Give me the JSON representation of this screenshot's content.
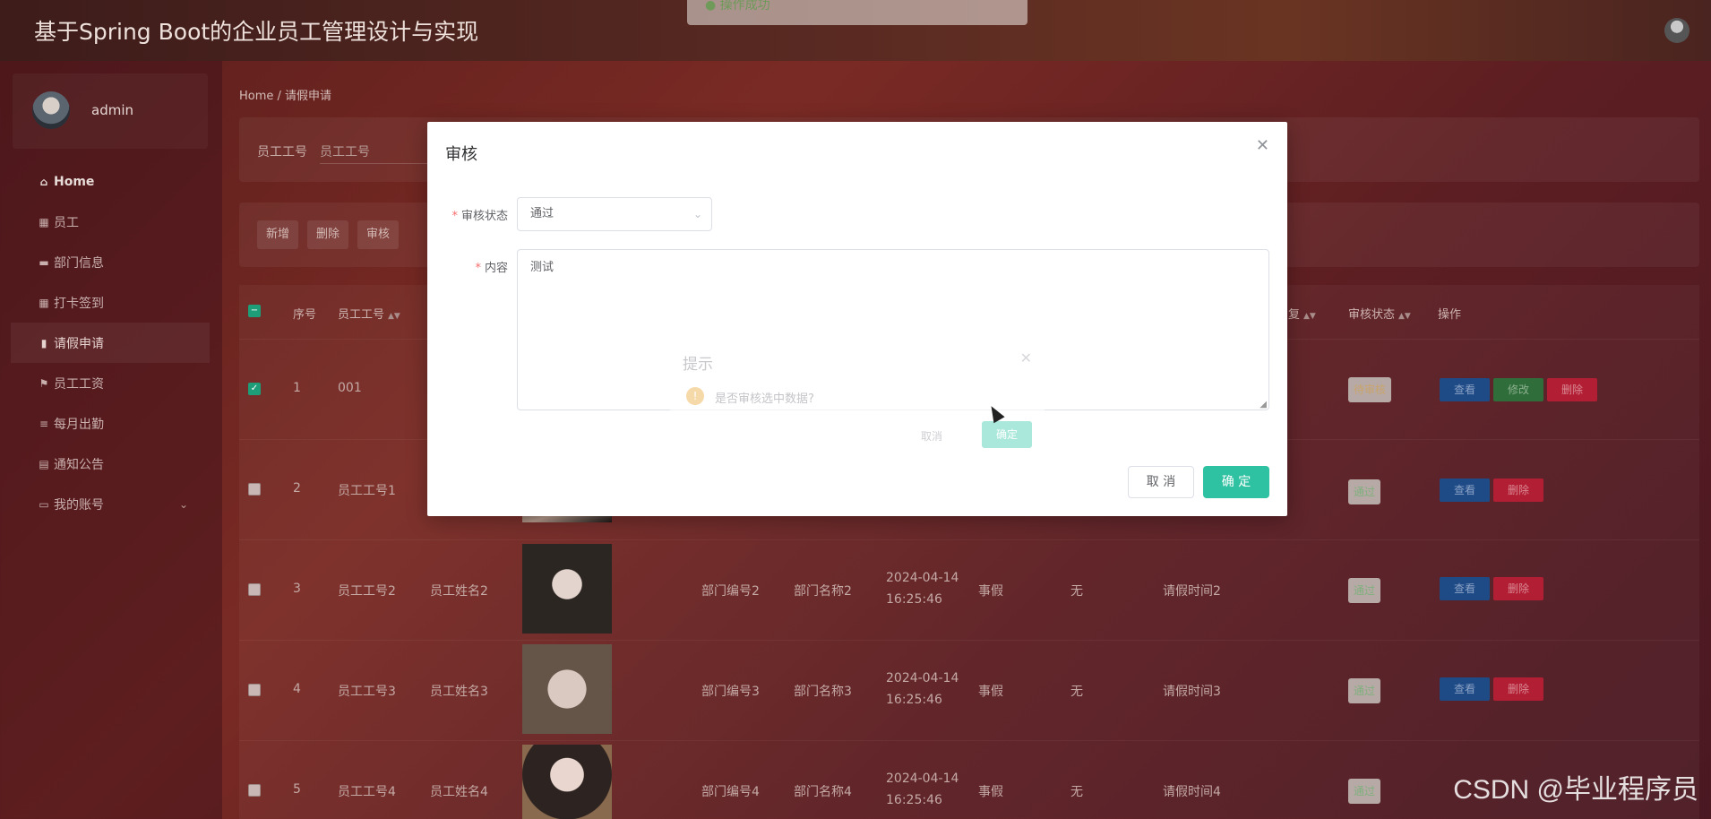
{
  "app": {
    "title": "基于Spring Boot的企业员工管理设计与实现"
  },
  "toast": {
    "text": "操作成功"
  },
  "sidebar": {
    "user": "admin",
    "items": [
      {
        "label": "Home",
        "icon": "home-icon"
      },
      {
        "label": "员工",
        "icon": "grid-icon"
      },
      {
        "label": "部门信息",
        "icon": "chat-icon"
      },
      {
        "label": "打卡签到",
        "icon": "grid-icon"
      },
      {
        "label": "请假申请",
        "icon": "chart-icon"
      },
      {
        "label": "员工工资",
        "icon": "flag-icon"
      },
      {
        "label": "每月出勤",
        "icon": "sliders-icon"
      },
      {
        "label": "通知公告",
        "icon": "clipboard-icon"
      },
      {
        "label": "我的账号",
        "icon": "card-icon"
      }
    ]
  },
  "breadcrumb": "Home / 请假申请",
  "search": {
    "label": "员工工号",
    "placeholder": "员工工号"
  },
  "actions": {
    "add": "新增",
    "delete": "删除",
    "audit": "审核"
  },
  "table": {
    "headers": {
      "index": "序号",
      "emp_no": "员工工号",
      "reply": "回复",
      "status": "审核状态",
      "ops": "操作"
    },
    "rows": [
      {
        "index": "1",
        "emp_no": "001",
        "emp_name": "",
        "dept_no": "",
        "dept_name": "",
        "date": "",
        "time": "",
        "type": "",
        "reply": "",
        "leave_time": "",
        "status": "待审核"
      },
      {
        "index": "2",
        "emp_no": "员工工号1",
        "emp_name": "",
        "dept_no": "",
        "dept_name": "",
        "date": "",
        "time": "",
        "type": "",
        "reply": "",
        "leave_time": "",
        "status": "通过"
      },
      {
        "index": "3",
        "emp_no": "员工工号2",
        "emp_name": "员工姓名2",
        "dept_no": "部门编号2",
        "dept_name": "部门名称2",
        "date": "2024-04-14",
        "time": "16:25:46",
        "type": "事假",
        "reply": "无",
        "leave_time": "请假时间2",
        "status": "通过"
      },
      {
        "index": "4",
        "emp_no": "员工工号3",
        "emp_name": "员工姓名3",
        "dept_no": "部门编号3",
        "dept_name": "部门名称3",
        "date": "2024-04-14",
        "time": "16:25:46",
        "type": "事假",
        "reply": "无",
        "leave_time": "请假时间3",
        "status": "通过"
      },
      {
        "index": "5",
        "emp_no": "员工工号4",
        "emp_name": "员工姓名4",
        "dept_no": "部门编号4",
        "dept_name": "部门名称4",
        "date": "2024-04-14",
        "time": "16:25:46",
        "type": "事假",
        "reply": "无",
        "leave_time": "请假时间4",
        "status": "通过"
      }
    ],
    "op_labels": {
      "view": "查看",
      "edit": "修改",
      "delete": "删除"
    }
  },
  "dialog": {
    "title": "审核",
    "status_label": "审核状态",
    "status_value": "通过",
    "content_label": "内容",
    "content_value": "测试",
    "cancel": "取 消",
    "ok": "确 定"
  },
  "confirm": {
    "title": "提示",
    "message": "是否审核选中数据?",
    "cancel": "取消",
    "ok": "确定"
  },
  "watermark": "CSDN @毕业程序员",
  "colors": {
    "primary": "#2fc2a2",
    "view": "#1e4a86",
    "edit": "#2f6d3a",
    "delete": "#b21e33",
    "required": "#f56c6c"
  }
}
